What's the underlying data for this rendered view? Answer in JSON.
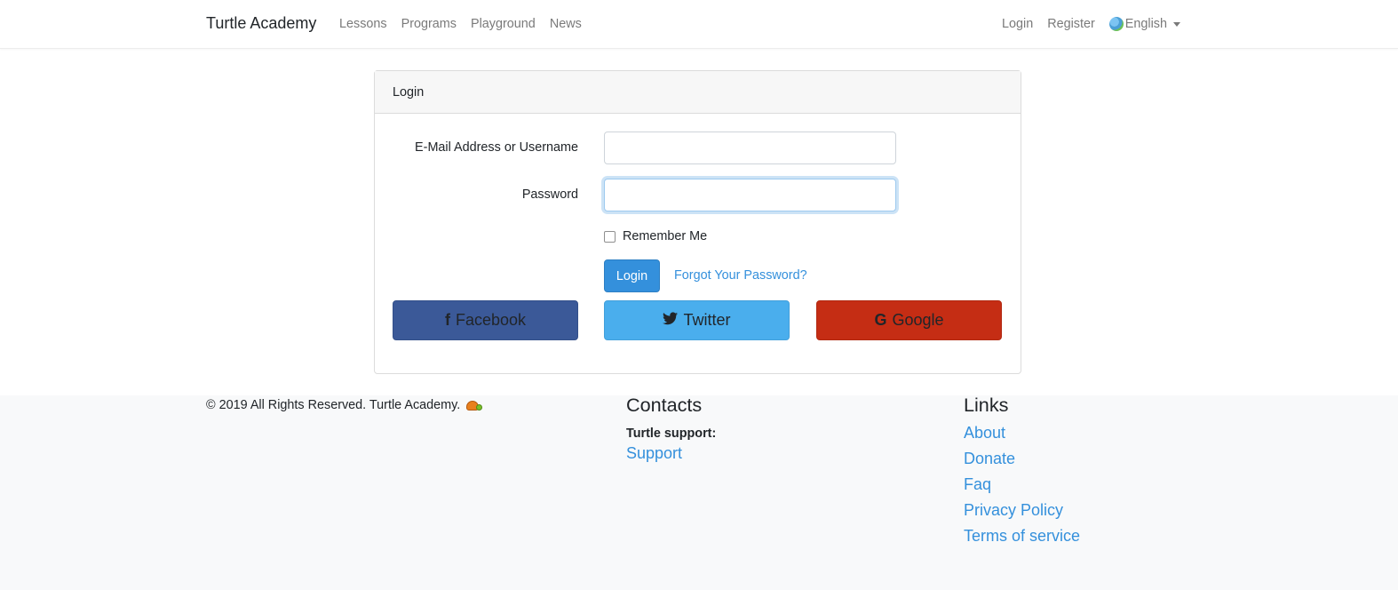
{
  "navbar": {
    "brand": "Turtle Academy",
    "left_links": [
      "Lessons",
      "Programs",
      "Playground",
      "News"
    ],
    "login": "Login",
    "register": "Register",
    "language": "English",
    "language_icon": "globe-icon"
  },
  "card": {
    "header": "Login",
    "email_label": "E-Mail Address or Username",
    "email_value": "",
    "password_label": "Password",
    "password_value": "",
    "remember_label": "Remember Me",
    "remember_checked": false,
    "login_button": "Login",
    "forgot_link": "Forgot Your Password?",
    "social": {
      "facebook": {
        "label": "Facebook",
        "icon": "facebook-icon",
        "color": "#3b5998"
      },
      "twitter": {
        "label": "Twitter",
        "icon": "twitter-icon",
        "color": "#4aaeed"
      },
      "google": {
        "label": "Google",
        "icon": "google-icon",
        "color": "#c52d14"
      }
    }
  },
  "footer": {
    "copyright": "©  2019 All Rights Reserved. Turtle Academy.",
    "contacts_heading": "Contacts",
    "support_label": "Turtle support:",
    "support_link": "Support",
    "links_heading": "Links",
    "links": [
      "About",
      "Donate",
      "Faq",
      "Privacy Policy",
      "Terms of service"
    ]
  },
  "colors": {
    "accent": "#3490dc",
    "footer_bg": "#f8f9fa"
  }
}
